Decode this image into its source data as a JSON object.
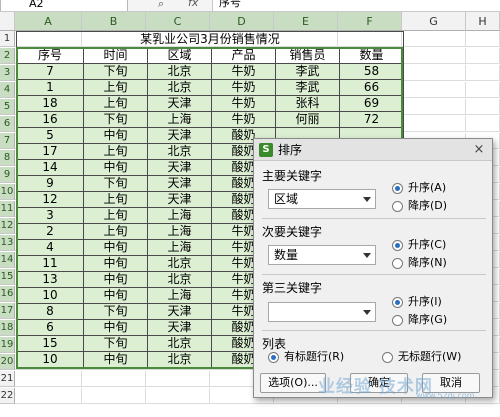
{
  "formula_bar": {
    "name_box": "A2",
    "fx": "fx",
    "zoom_icon": "magnifier-icon",
    "content": "序号"
  },
  "columns": [
    "A",
    "B",
    "C",
    "D",
    "E",
    "F",
    "G",
    "H"
  ],
  "rows": [
    "1",
    "2",
    "3",
    "4",
    "5",
    "6",
    "7",
    "8",
    "9",
    "10",
    "11",
    "12",
    "13",
    "14",
    "15",
    "16",
    "17",
    "18",
    "19",
    "20",
    "21",
    "22"
  ],
  "sheet": {
    "title": "某乳业公司3月份销售情况",
    "headers": [
      "序号",
      "时间",
      "区域",
      "产品",
      "销售员",
      "数量"
    ],
    "rows": [
      [
        "7",
        "下旬",
        "北京",
        "牛奶",
        "李武",
        "58"
      ],
      [
        "1",
        "上旬",
        "北京",
        "牛奶",
        "李武",
        "66"
      ],
      [
        "18",
        "上旬",
        "天津",
        "牛奶",
        "张科",
        "69"
      ],
      [
        "16",
        "下旬",
        "上海",
        "牛奶",
        "何丽",
        "72"
      ],
      [
        "5",
        "中旬",
        "天津",
        "酸奶",
        "",
        ""
      ],
      [
        "17",
        "上旬",
        "北京",
        "酸奶",
        "",
        ""
      ],
      [
        "14",
        "中旬",
        "天津",
        "酸奶",
        "",
        ""
      ],
      [
        "9",
        "下旬",
        "天津",
        "酸奶",
        "",
        ""
      ],
      [
        "12",
        "上旬",
        "天津",
        "酸奶",
        "",
        ""
      ],
      [
        "3",
        "上旬",
        "上海",
        "酸奶",
        "",
        ""
      ],
      [
        "2",
        "上旬",
        "上海",
        "牛奶",
        "",
        ""
      ],
      [
        "4",
        "中旬",
        "上海",
        "牛奶",
        "",
        ""
      ],
      [
        "11",
        "中旬",
        "北京",
        "牛奶",
        "",
        ""
      ],
      [
        "13",
        "中旬",
        "北京",
        "牛奶",
        "",
        ""
      ],
      [
        "10",
        "中旬",
        "上海",
        "牛奶",
        "",
        ""
      ],
      [
        "8",
        "下旬",
        "天津",
        "牛奶",
        "",
        ""
      ],
      [
        "6",
        "中旬",
        "天津",
        "酸奶",
        "",
        ""
      ],
      [
        "15",
        "下旬",
        "北京",
        "酸奶",
        "",
        ""
      ],
      [
        "10",
        "中旬",
        "北京",
        "酸奶",
        "",
        ""
      ]
    ]
  },
  "dialog": {
    "title": "排序",
    "icon": "wps-sheet-icon",
    "close": "×",
    "primary_key": {
      "label": "主要关键字",
      "value": "区域",
      "asc": "升序(A)",
      "desc": "降序(D)",
      "order": "asc"
    },
    "secondary_key": {
      "label": "次要关键字",
      "value": "数量",
      "asc": "升序(C)",
      "desc": "降序(N)",
      "order": "asc"
    },
    "third_key": {
      "label": "第三关键字",
      "value": "",
      "asc": "升序(I)",
      "desc": "降序(G)",
      "order": "asc"
    },
    "list": {
      "label": "列表",
      "has_header": "有标题行(R)",
      "no_header": "无标题行(W)",
      "selected": "has_header"
    },
    "buttons": {
      "options": "选项(O)...",
      "ok": "确定",
      "cancel": "取消"
    }
  },
  "watermark": {
    "text": "业经验 技术网",
    "sub": "www.52dj.com"
  },
  "colors": {
    "selection_fill": "#dcefd3",
    "selection_border": "#4b8a3a",
    "accent": "#2a6fbf"
  }
}
